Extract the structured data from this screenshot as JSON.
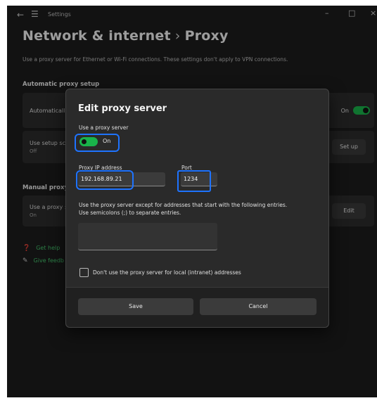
{
  "window": {
    "app_title": "Settings",
    "back_glyph": "←",
    "menu_glyph": "☰",
    "minimize_glyph": "–",
    "maximize_glyph": "□",
    "close_glyph": "×"
  },
  "header": {
    "parent": "Network & internet",
    "separator": "›",
    "current": "Proxy"
  },
  "description": "Use a proxy server for Ethernet or Wi-Fi connections. These settings don't apply to VPN connections.",
  "automatic": {
    "section_title": "Automatic proxy setup",
    "detect_label": "Automaticall",
    "detect_state": "On",
    "script_label": "Use setup sc",
    "script_state": "Off",
    "setup_button": "Set up"
  },
  "manual": {
    "section_title": "Manual proxy s",
    "label": "Use a proxy :",
    "state": "On",
    "edit_button": "Edit"
  },
  "links": {
    "help": "Get help",
    "feedback": "Give feedb"
  },
  "dialog": {
    "title": "Edit proxy server",
    "use_proxy_label": "Use a proxy server",
    "toggle_state": "On",
    "ip_label": "Proxy IP address",
    "ip_value": "192.168.89.21",
    "port_label": "Port",
    "port_value": "1234",
    "exceptions_text_1": "Use the proxy server except for addresses that start with the following entries.",
    "exceptions_text_2": "Use semicolons (;) to separate entries.",
    "exceptions_value": "",
    "local_checkbox_label": "Don't use the proxy server for local (intranet) addresses",
    "save_button": "Save",
    "cancel_button": "Cancel"
  },
  "colors": {
    "background": "#1c1c1c",
    "toggle_on": "#19b34a",
    "link": "#43c06b",
    "annotation": "#1e73ff"
  }
}
